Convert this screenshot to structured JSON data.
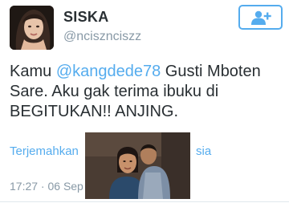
{
  "profile": {
    "display_name": "SISKA",
    "handle": "@ncisznciszz"
  },
  "follow_button": {
    "icon": "add-user-icon",
    "color": "#55acee"
  },
  "tweet": {
    "text_before_mention": "Kamu ",
    "mention": "@kangdede78",
    "text_after_mention": " Gusti Mboten Sare. Aku gak terima ibuku di BEGITUKAN!! ANJING."
  },
  "translate": {
    "label": "Terjemahkan",
    "label_tail": "sia"
  },
  "timestamp": "17:27 · 06 Sep",
  "colors": {
    "accent": "#55acee",
    "text": "#292f33",
    "muted": "#8899a6"
  }
}
